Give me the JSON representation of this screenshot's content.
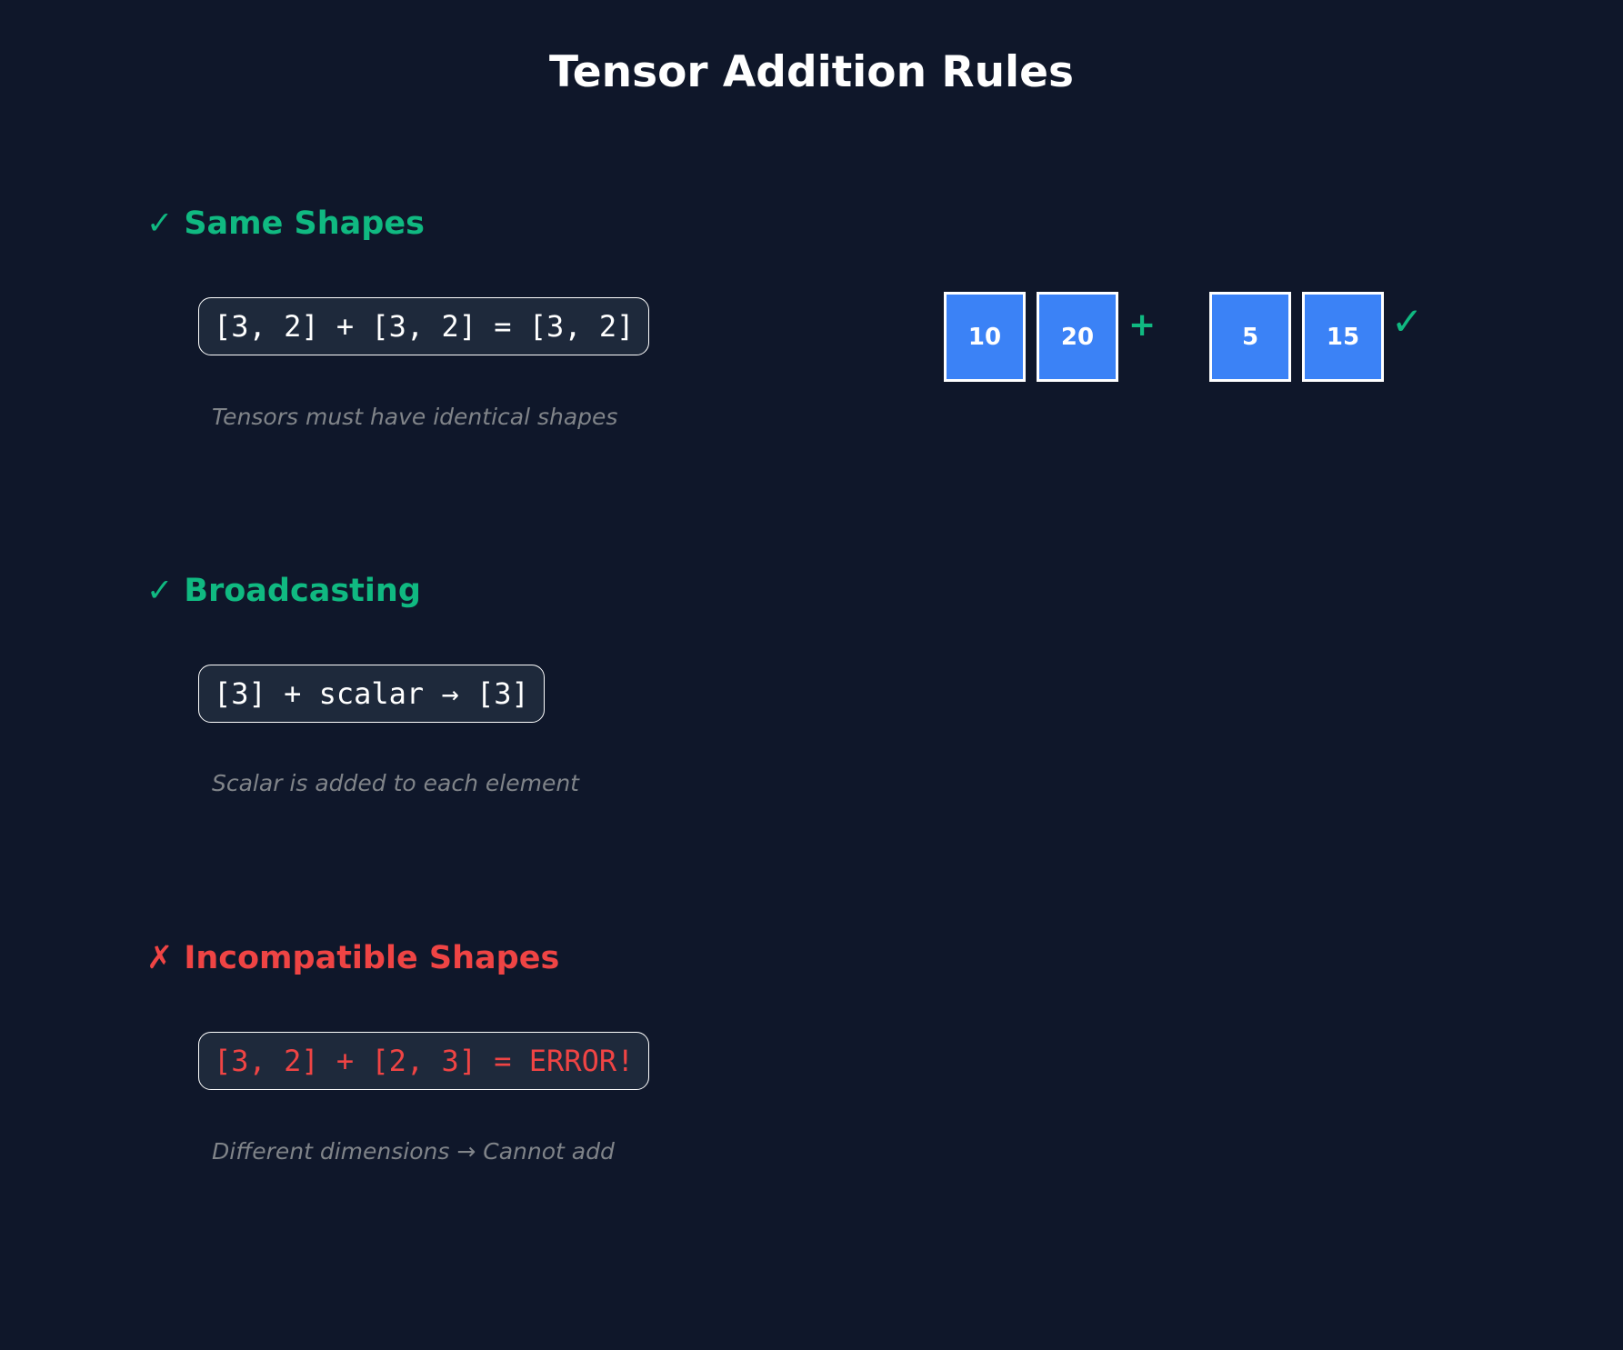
{
  "title": "Tensor Addition Rules",
  "colors": {
    "background": "#0f172a",
    "success": "#10b981",
    "error": "#ef4444",
    "cell_fill": "#3b82f6",
    "muted_text": "#808489",
    "code_box_fill": "#1e293b"
  },
  "rules": [
    {
      "mark": "✓",
      "heading": "Same Shapes",
      "code": "[3, 2] + [3, 2] = [3, 2]",
      "note": "Tensors must have identical shapes"
    },
    {
      "mark": "✓",
      "heading": "Broadcasting",
      "code": "[3] + scalar → [3]",
      "note": "Scalar is added to each element"
    },
    {
      "mark": "✗",
      "heading": "Incompatible Shapes",
      "code": "[3, 2] + [2, 3] = ERROR!",
      "note": "Different dimensions → Cannot add"
    }
  ],
  "example": {
    "tensor_a": [
      "10",
      "20"
    ],
    "operator": "+",
    "tensor_b": [
      "5",
      "15"
    ],
    "result_mark": "✓",
    "icons": {
      "plus": "plus-icon",
      "result": "check-icon"
    }
  }
}
